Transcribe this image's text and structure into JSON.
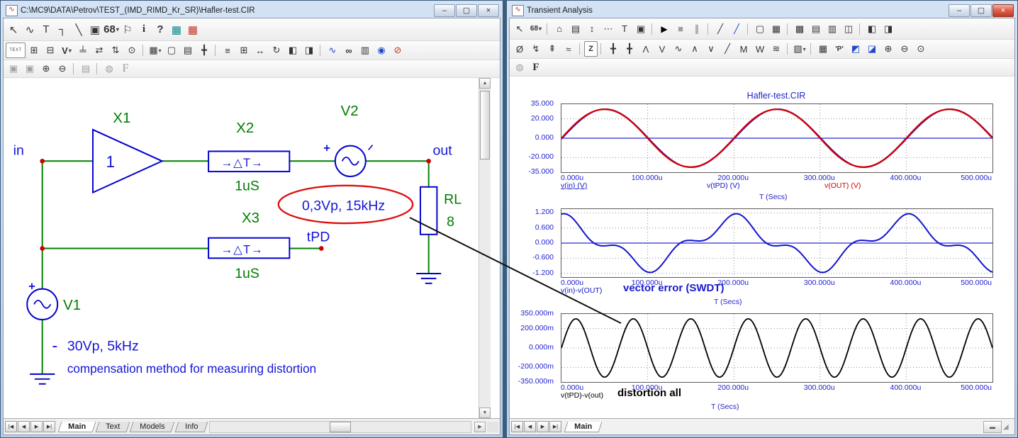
{
  "colors": {
    "component_blue": "#0000cf",
    "wire_green": "#008000",
    "label_green": "#007d00",
    "node_red": "#d00000",
    "annotation_red": "#dd1111",
    "text_blue": "#1515d8",
    "trace_red": "#d40000",
    "trace_blue": "#1414cc",
    "trace_black": "#000000",
    "zero_line_blue": "#2929d6"
  },
  "left_window": {
    "title": "C:\\MC9\\DATA\\Petrov\\TEST_(IMD_RIMD_Kr_SR)\\Hafler-test.CIR",
    "icon_glyph": "∿",
    "window_buttons": [
      {
        "name": "minimize-button",
        "glyph": "–"
      },
      {
        "name": "maximize-button",
        "glyph": "▢"
      },
      {
        "name": "close-button",
        "glyph": "×"
      }
    ],
    "toolbar1": [
      {
        "name": "select-icon",
        "glyph": "↖"
      },
      {
        "name": "sine-source-icon",
        "glyph": "∿"
      },
      {
        "name": "text-icon",
        "glyph": "T"
      },
      {
        "name": "wire-icon",
        "glyph": "┐"
      },
      {
        "name": "line-icon",
        "glyph": "╲"
      },
      {
        "name": "graphics-icon",
        "glyph": "▣"
      },
      {
        "name": "component-68-icon",
        "glyph": "68",
        "cls": "has-dd sm"
      },
      {
        "name": "flag-icon",
        "glyph": "⚐"
      },
      {
        "name": "info-icon",
        "glyph": "i",
        "cls": "serif-bold"
      },
      {
        "name": "help-mode-icon",
        "glyph": "?",
        "cls": "bold"
      },
      {
        "name": "window-tile-icon",
        "glyph": "▦",
        "cls": "teal"
      },
      {
        "name": "window-cascade-icon",
        "glyph": "▦",
        "cls": "red"
      }
    ],
    "toolbar2": [
      {
        "name": "text-region-icon",
        "glyph": "TEXT",
        "cls": "boxed"
      },
      {
        "name": "pin-connections-icon",
        "glyph": "⊞"
      },
      {
        "name": "pin-names-icon",
        "glyph": "⊟"
      },
      {
        "name": "node-voltages-icon",
        "glyph": "V",
        "cls": "has-dd bold"
      },
      {
        "name": "ground-icon",
        "glyph": "╧"
      },
      {
        "name": "current-icon",
        "glyph": "⇄"
      },
      {
        "name": "power-icon",
        "glyph": "⇅"
      },
      {
        "name": "condition-icon",
        "glyph": "⊙"
      },
      {
        "name": "toolbar-separator",
        "glyph": "",
        "cls": "sep"
      },
      {
        "name": "grid-icon",
        "glyph": "▦",
        "cls": "has-dd"
      },
      {
        "name": "border-icon",
        "glyph": "▢"
      },
      {
        "name": "title-block-icon",
        "glyph": "▤"
      },
      {
        "name": "crosshair-icon",
        "glyph": "╋"
      },
      {
        "name": "toolbar-separator",
        "glyph": "",
        "cls": "sep"
      },
      {
        "name": "properties-icon",
        "glyph": "≡"
      },
      {
        "name": "box-select-icon",
        "glyph": "⊞"
      },
      {
        "name": "stretch-icon",
        "glyph": "↔"
      },
      {
        "name": "rotate-icon",
        "glyph": "↻"
      },
      {
        "name": "flip-x-icon",
        "glyph": "◧"
      },
      {
        "name": "flip-y-icon",
        "glyph": "◨"
      },
      {
        "name": "toolbar-separator",
        "glyph": "",
        "cls": "sep"
      },
      {
        "name": "sine-accent-icon",
        "glyph": "∿",
        "cls": "blue"
      },
      {
        "name": "find-icon",
        "glyph": "∞",
        "cls": "bold"
      },
      {
        "name": "display-icon",
        "glyph": "▥"
      },
      {
        "name": "help-circle-icon",
        "glyph": "◉",
        "cls": "blue"
      },
      {
        "name": "abort-icon",
        "glyph": "⊘",
        "cls": "red"
      }
    ],
    "toolbar3": [
      {
        "name": "copy-page-icon",
        "glyph": "▣",
        "cls": "dim"
      },
      {
        "name": "copy-page2-icon",
        "glyph": "▣",
        "cls": "dim"
      },
      {
        "name": "zoom-in-icon",
        "glyph": "⊕"
      },
      {
        "name": "zoom-out-icon",
        "glyph": "⊖"
      },
      {
        "name": "toolbar-separator",
        "glyph": "",
        "cls": "sep"
      },
      {
        "name": "image-icon",
        "glyph": "▤",
        "cls": "dim"
      },
      {
        "name": "toolbar-separator",
        "glyph": "",
        "cls": "sep"
      },
      {
        "name": "globe-icon",
        "glyph": "◍",
        "cls": "dim"
      },
      {
        "name": "font-icon",
        "glyph": "F",
        "cls": "serif-dim"
      }
    ],
    "schematic": {
      "node_in": "in",
      "node_out": "out",
      "node_tpd": "tPD",
      "x1_label": "X1",
      "x1_gain": "1",
      "x2_label": "X2",
      "x2_symbol": "→△T→",
      "x2_value": "1uS",
      "x3_label": "X3",
      "x3_symbol": "→△T→",
      "x3_value": "1uS",
      "v2_label": "V2",
      "v2_plus": "+",
      "v2_params": "0,3Vp, 15kHz",
      "rl_label": "RL",
      "rl_value": "8",
      "v1_label": "V1",
      "v1_plus": "+",
      "v1_minus": "-",
      "v1_params": "30Vp, 5kHz",
      "note": "compensation method for measuring distortion"
    },
    "nav": [
      "|◀",
      "◀",
      "▶",
      "▶|"
    ],
    "tabs": [
      {
        "name": "tab-main",
        "label": "Main",
        "cls": "sel"
      },
      {
        "name": "tab-text",
        "label": "Text"
      },
      {
        "name": "tab-models",
        "label": "Models"
      },
      {
        "name": "tab-info",
        "label": "Info"
      }
    ],
    "scroll": {
      "up": "▲",
      "down": "▼",
      "right": "▶"
    }
  },
  "right_window": {
    "title": "Transient Analysis",
    "icon_glyph": "∿",
    "window_buttons": [
      {
        "name": "minimize-button",
        "glyph": "–"
      },
      {
        "name": "maximize-button",
        "glyph": "▢"
      },
      {
        "name": "close-button",
        "glyph": "×",
        "cls": "close-red"
      }
    ],
    "toolbar1": [
      {
        "name": "select-icon",
        "glyph": "↖"
      },
      {
        "name": "numeric-limits-icon",
        "glyph": "68",
        "cls": "has-dd sm"
      },
      {
        "name": "toolbar-separator",
        "glyph": "",
        "cls": "sep"
      },
      {
        "name": "scope-icon",
        "glyph": "⌂"
      },
      {
        "name": "analysis-limits-icon",
        "glyph": "▤"
      },
      {
        "name": "data-points-icon",
        "glyph": "↕"
      },
      {
        "name": "tokens-icon",
        "glyph": "⋯"
      },
      {
        "name": "text-icon",
        "glyph": "T"
      },
      {
        "name": "properties-icon",
        "glyph": "▣"
      },
      {
        "name": "toolbar-separator",
        "glyph": "",
        "cls": "sep"
      },
      {
        "name": "run-icon",
        "glyph": "▶",
        "cls": "run"
      },
      {
        "name": "stop-icon",
        "glyph": "■",
        "cls": "dim"
      },
      {
        "name": "pause-icon",
        "glyph": "∥",
        "cls": "dim bold"
      },
      {
        "name": "toolbar-separator",
        "glyph": "",
        "cls": "sep"
      },
      {
        "name": "cursor-slash-icon",
        "glyph": "╱"
      },
      {
        "name": "cursor-measure-icon",
        "glyph": "╱",
        "cls": "blue"
      },
      {
        "name": "toolbar-separator",
        "glyph": "",
        "cls": "sep"
      },
      {
        "name": "single-pane-icon",
        "glyph": "▢"
      },
      {
        "name": "grid-pane-icon",
        "glyph": "▦"
      },
      {
        "name": "toolbar-separator",
        "glyph": "",
        "cls": "sep"
      },
      {
        "name": "layout-stack-icon",
        "glyph": "▩"
      },
      {
        "name": "layout-rows-icon",
        "glyph": "▤"
      },
      {
        "name": "layout-cols-icon",
        "glyph": "▥"
      },
      {
        "name": "layout-quad-icon",
        "glyph": "◫"
      },
      {
        "name": "toolbar-separator",
        "glyph": "",
        "cls": "sep"
      },
      {
        "name": "split-horizontal-icon",
        "glyph": "◧"
      },
      {
        "name": "split-vertical-icon",
        "glyph": "◨"
      }
    ],
    "toolbar2": [
      {
        "name": "no-trace-icon",
        "glyph": "Ø"
      },
      {
        "name": "retrace-icon",
        "glyph": "↯"
      },
      {
        "name": "go-next-icon",
        "glyph": "⇞"
      },
      {
        "name": "wave-tag-icon",
        "glyph": "≈"
      },
      {
        "name": "toolbar-separator",
        "glyph": "",
        "cls": "sep"
      },
      {
        "name": "zoom-mode-icon",
        "glyph": "Z",
        "cls": "boxed-sm"
      },
      {
        "name": "toolbar-separator",
        "glyph": "",
        "cls": "sep"
      },
      {
        "name": "cursor-left-icon",
        "glyph": "╋"
      },
      {
        "name": "cursor-right-icon",
        "glyph": "╋"
      },
      {
        "name": "peak-icon",
        "glyph": "Λ"
      },
      {
        "name": "valley-icon",
        "glyph": "V"
      },
      {
        "name": "wave-icon",
        "glyph": "∿"
      },
      {
        "name": "high-icon",
        "glyph": "∧"
      },
      {
        "name": "low-icon",
        "glyph": "∨"
      },
      {
        "name": "slope-icon",
        "glyph": "╱"
      },
      {
        "name": "local-max-icon",
        "glyph": "M"
      },
      {
        "name": "local-min-icon",
        "glyph": "W"
      },
      {
        "name": "period-icon",
        "glyph": "≋"
      },
      {
        "name": "toolbar-separator",
        "glyph": "",
        "cls": "sep"
      },
      {
        "name": "color-menu-icon",
        "glyph": "▧",
        "cls": "has-dd"
      },
      {
        "name": "toolbar-separator",
        "glyph": "",
        "cls": "sep"
      },
      {
        "name": "data-table-icon",
        "glyph": "▦"
      },
      {
        "name": "format-icon",
        "glyph": "'P'",
        "cls": "sm"
      },
      {
        "name": "tag-horizontal-icon",
        "glyph": "◩",
        "cls": "blue"
      },
      {
        "name": "tag-vertical-icon",
        "glyph": "◪",
        "cls": "blue"
      },
      {
        "name": "zoom-in-icon",
        "glyph": "⊕"
      },
      {
        "name": "zoom-out-icon",
        "glyph": "⊖"
      },
      {
        "name": "zoom-fit-icon",
        "glyph": "⊙"
      }
    ],
    "toolbar3": [
      {
        "name": "globe-icon",
        "glyph": "◍",
        "cls": "dim"
      },
      {
        "name": "font-icon",
        "glyph": "F",
        "cls": "serif-bold"
      }
    ],
    "nav": [
      "|◀",
      "◀",
      "▶",
      "▶|"
    ],
    "tabs": [
      {
        "name": "tab-main",
        "label": "Main",
        "cls": "sel"
      }
    ],
    "scroll_stub": "▬",
    "resize_grip": "◢"
  },
  "chart_data": {
    "type": "line",
    "title": "Hafler-test.CIR",
    "x_range_us": [
      0,
      500
    ],
    "x_ticks": [
      "0.000u",
      "100.000u",
      "200.000u",
      "300.000u",
      "400.000u",
      "500.000u"
    ],
    "grid": true,
    "plots": [
      {
        "name": "input-output",
        "ylim": [
          -35,
          35
        ],
        "y_ticks": [
          "35.000",
          "20.000",
          "0.000",
          "-20.000",
          "-35.000"
        ],
        "zero_line_color": "#2929d6",
        "series": [
          {
            "name": "v(in) (V)",
            "color": "#1414cc",
            "width": 1.6,
            "components": [
              {
                "amp": 30,
                "freq_hz": 5000,
                "phase_deg": 0
              }
            ]
          },
          {
            "name": "v(tPD) (V)",
            "color": "#1414cc",
            "width": 1.6,
            "components": [
              {
                "amp": 30,
                "freq_hz": 5000,
                "phase_deg": -1.8
              }
            ]
          },
          {
            "name": "v(OUT) (V)",
            "color": "#d40000",
            "width": 2.2,
            "components": [
              {
                "amp": 30,
                "freq_hz": 5000,
                "phase_deg": 0
              },
              {
                "amp": 0.3,
                "freq_hz": 15000,
                "phase_deg": 0
              }
            ]
          }
        ],
        "xlabel": "T (Secs)"
      },
      {
        "name": "vector-error",
        "ylim": [
          -1.35,
          1.35
        ],
        "y_ticks": [
          "1.200",
          "0.600",
          "0.000",
          "-0.600",
          "-1.200"
        ],
        "zero_line_color": "#2929d6",
        "series": [
          {
            "name": "v(in)-v(OUT)",
            "color": "#1414cc",
            "width": 2,
            "components": [
              {
                "amp": 0.85,
                "freq_hz": 5000,
                "phase_deg": 90
              },
              {
                "amp": 0.32,
                "freq_hz": 15000,
                "phase_deg": 70
              }
            ]
          }
        ],
        "annotation": "vector error (SWDT)",
        "xlabel": "T (Secs)"
      },
      {
        "name": "distortion",
        "ylim": [
          -0.35,
          0.35
        ],
        "y_ticks": [
          "350.000m",
          "200.000m",
          "0.000m",
          "-200.000m",
          "-350.000m"
        ],
        "series": [
          {
            "name": "v(tPD)-v(out)",
            "color": "#000000",
            "width": 1.8,
            "components": [
              {
                "amp": 0.3,
                "freq_hz": 15000,
                "phase_deg": 0
              }
            ]
          }
        ],
        "annotation": "distortion all",
        "xlabel": "T (Secs)"
      }
    ]
  }
}
